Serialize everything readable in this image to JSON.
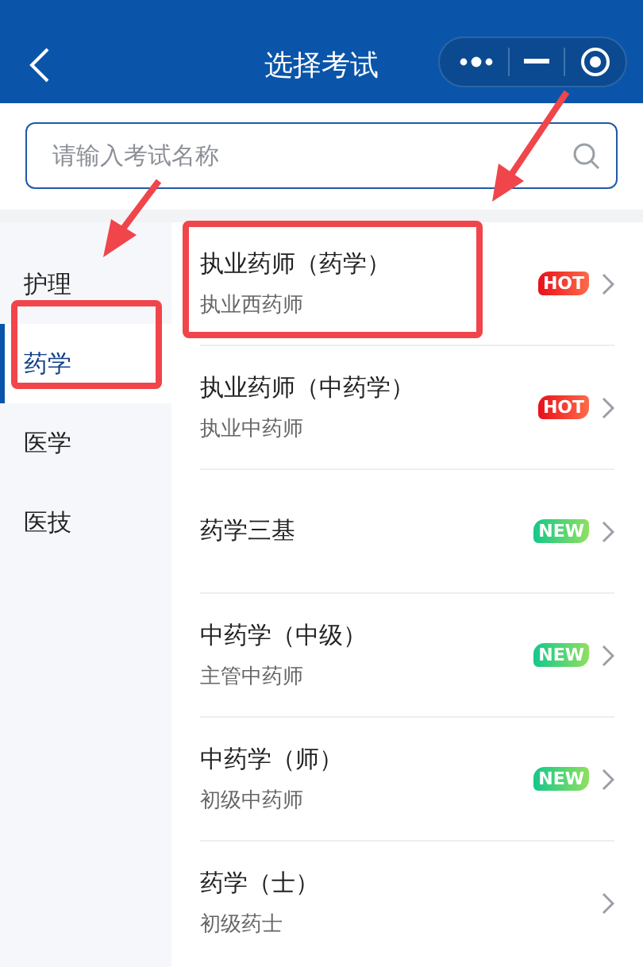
{
  "header": {
    "title": "选择考试"
  },
  "search": {
    "placeholder": "请输入考试名称"
  },
  "sidebar": {
    "items": [
      {
        "label": "护理",
        "selected": false
      },
      {
        "label": "药学",
        "selected": true
      },
      {
        "label": "医学",
        "selected": false
      },
      {
        "label": "医技",
        "selected": false
      }
    ]
  },
  "exams": [
    {
      "title": "执业药师（药学）",
      "subtitle": "执业西药师",
      "badge": {
        "kind": "hot",
        "text": "HOT"
      }
    },
    {
      "title": "执业药师（中药学）",
      "subtitle": "执业中药师",
      "badge": {
        "kind": "hot",
        "text": "HOT"
      }
    },
    {
      "title": "药学三基",
      "badge": {
        "kind": "new",
        "text": "NEW"
      }
    },
    {
      "title": "中药学（中级）",
      "subtitle": "主管中药师",
      "badge": {
        "kind": "new",
        "text": "NEW"
      }
    },
    {
      "title": "中药学（师）",
      "subtitle": "初级中药师",
      "badge": {
        "kind": "new",
        "text": "NEW"
      }
    },
    {
      "title": "药学（士）",
      "subtitle": "初级药士"
    }
  ]
}
